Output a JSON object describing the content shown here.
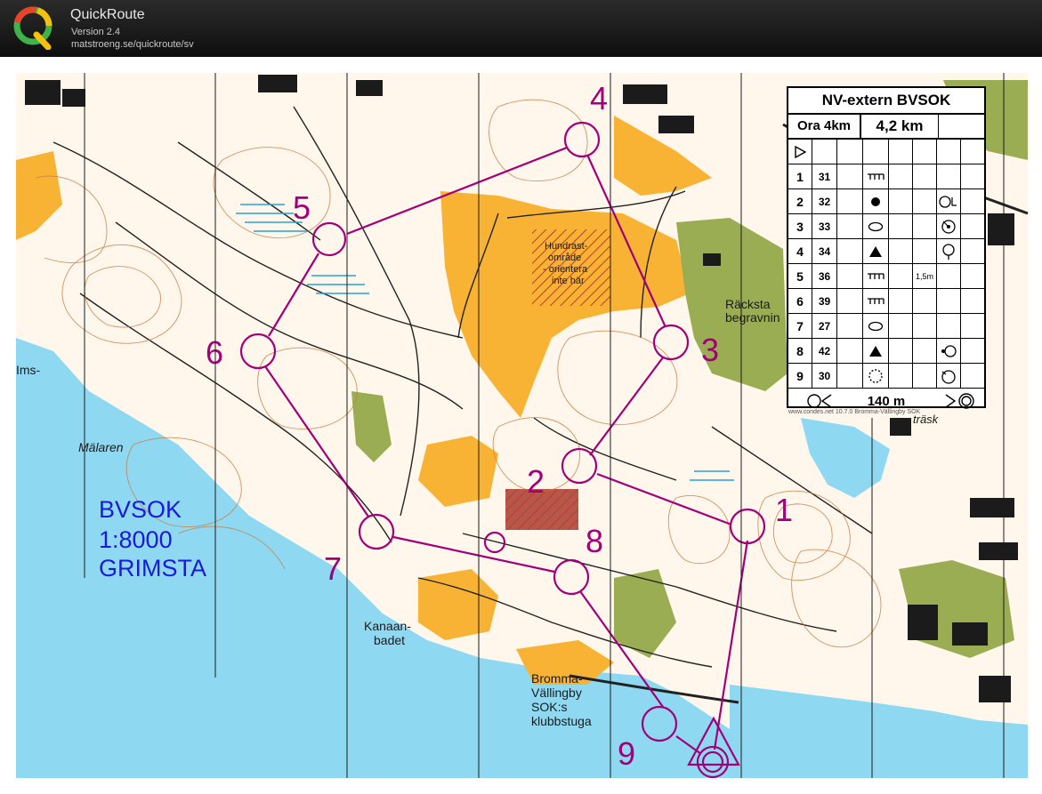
{
  "app": {
    "title": "QuickRoute",
    "version": "Version 2.4",
    "url": "matstroeng.se/quickroute/sv"
  },
  "map": {
    "label_block": {
      "club": "BVSOK",
      "scale": "1:8000",
      "area": "GRIMSTA"
    },
    "place_names": {
      "hundrast": "Hundrast-",
      "hundrast2": "område",
      "hundrast3": "- orientera",
      "hundrast4": "inte här",
      "racksta": "Räcksta",
      "racksta2": "begravnin",
      "mallaren": "Mälaren",
      "ims": "Ims-",
      "kanaan": "Kanaan-",
      "kanaan2": "badet",
      "bromma": "Bromma-",
      "bromma2": "Vällingby",
      "bromma3": "SOK:s",
      "bromma4": "klubbstuga",
      "trask": "träsk"
    },
    "controls": [
      {
        "number": "1"
      },
      {
        "number": "2"
      },
      {
        "number": "3"
      },
      {
        "number": "4"
      },
      {
        "number": "5"
      },
      {
        "number": "6"
      },
      {
        "number": "7"
      },
      {
        "number": "8"
      },
      {
        "number": "9"
      }
    ]
  },
  "description_sheet": {
    "event": "NV-extern BVSOK",
    "class": "Ora 4km",
    "length": "4,2 km",
    "rows": [
      {
        "num": "1",
        "code": "31",
        "feature": "ditch-symbol",
        "extra": "",
        "position": ""
      },
      {
        "num": "2",
        "code": "32",
        "feature": "dot-symbol",
        "extra": "",
        "position": "ol-symbol"
      },
      {
        "num": "3",
        "code": "33",
        "feature": "ellipse-symbol",
        "extra": "",
        "position": "circle-dot-symbol"
      },
      {
        "num": "4",
        "code": "34",
        "feature": "triangle-symbol",
        "extra": "",
        "position": "circle-tail-symbol"
      },
      {
        "num": "5",
        "code": "36",
        "feature": "ditch-symbol",
        "extra": "1,5m",
        "position": ""
      },
      {
        "num": "6",
        "code": "39",
        "feature": "ditch-symbol",
        "extra": "",
        "position": ""
      },
      {
        "num": "7",
        "code": "27",
        "feature": "ellipse-symbol",
        "extra": "",
        "position": ""
      },
      {
        "num": "8",
        "code": "42",
        "feature": "triangle-symbol",
        "extra": "",
        "position": "dot-circle-symbol"
      },
      {
        "num": "9",
        "code": "30",
        "feature": "dotted-circle-symbol",
        "extra": "",
        "position": "arc-circle-symbol"
      }
    ],
    "finish_distance": "140 m",
    "copyright": "www.condes.net 10.7.0 Bromma-Vällingby SOK"
  },
  "colors": {
    "course": "#a1007a",
    "water": "#8fd8f2",
    "open": "#f8b334",
    "green": "#9aad52",
    "title_blue": "#1a1adc"
  }
}
